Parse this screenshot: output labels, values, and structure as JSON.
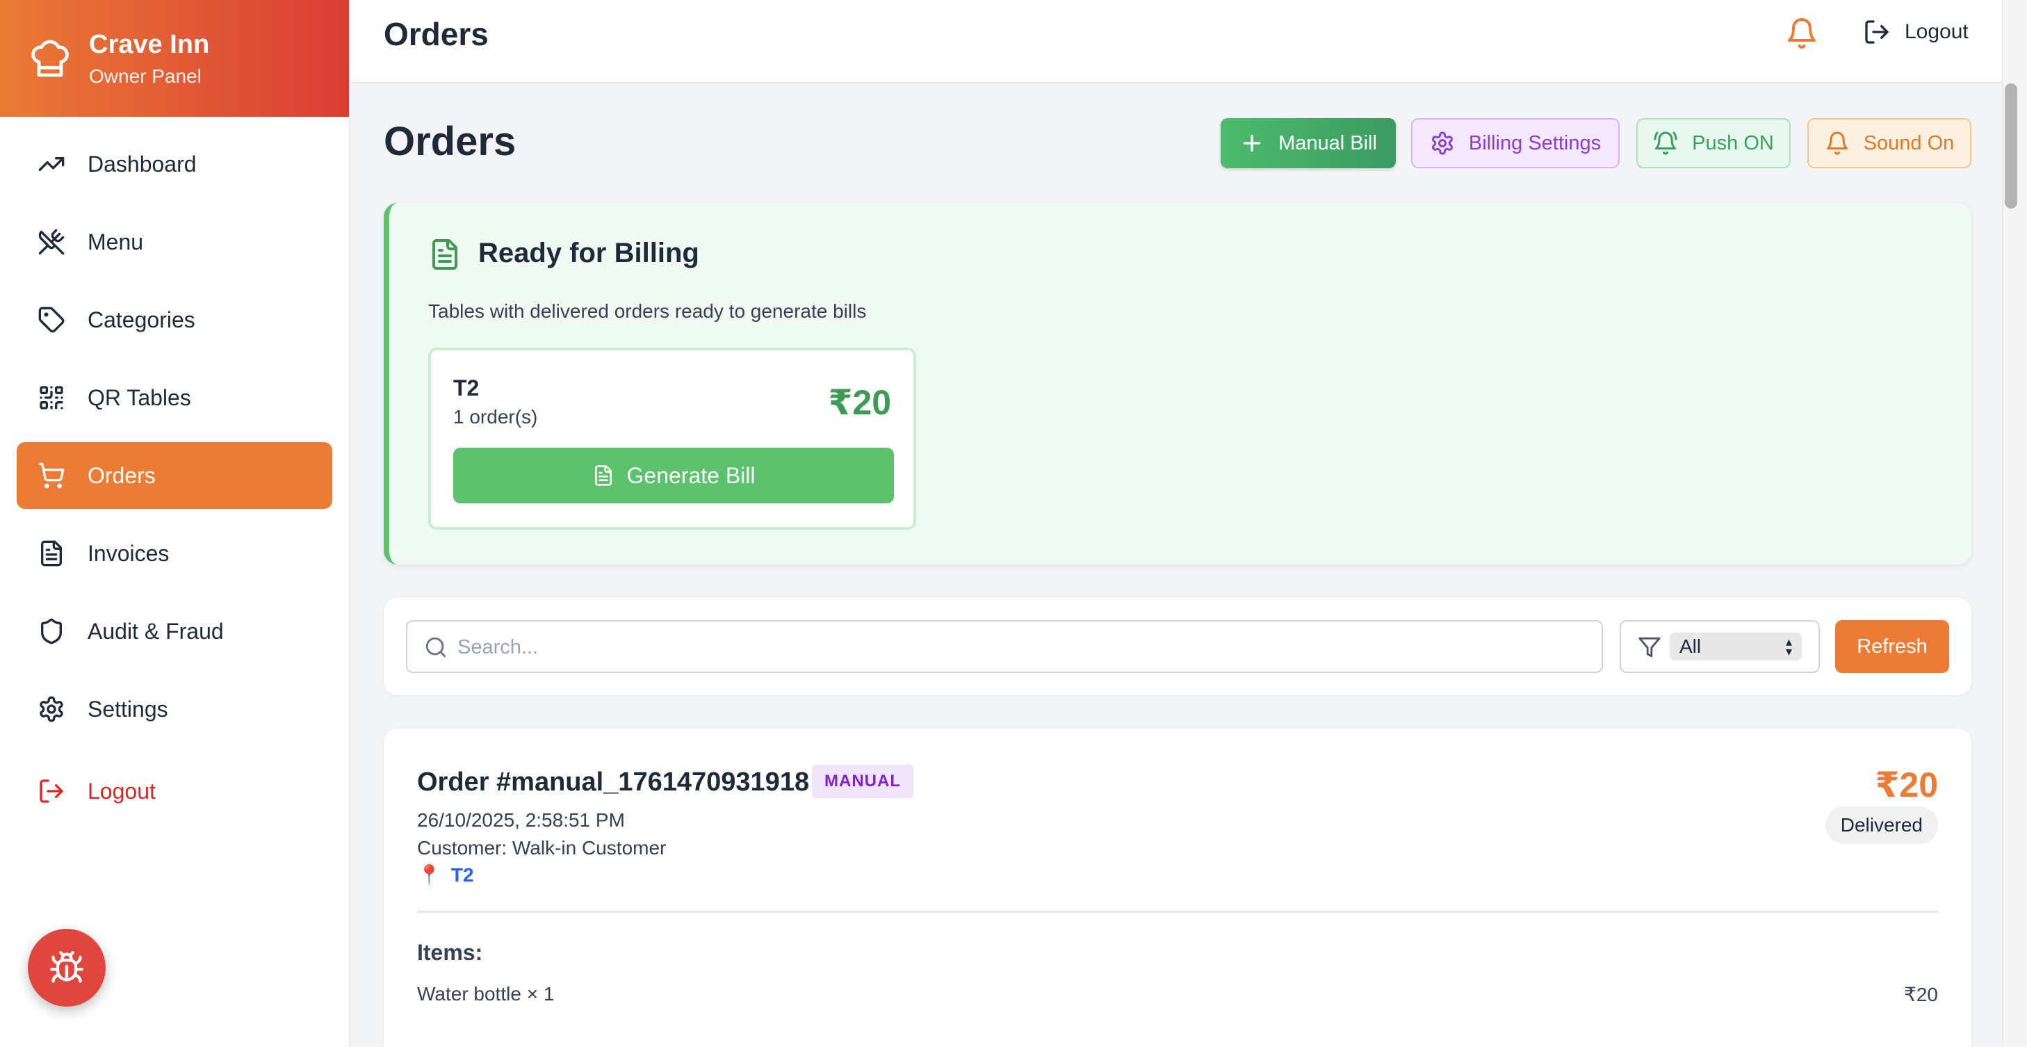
{
  "brand": {
    "title": "Crave Inn",
    "subtitle": "Owner Panel"
  },
  "sidebar": {
    "items": [
      {
        "label": "Dashboard",
        "icon": "trending-up-icon"
      },
      {
        "label": "Menu",
        "icon": "utensils-icon"
      },
      {
        "label": "Categories",
        "icon": "tag-icon"
      },
      {
        "label": "QR Tables",
        "icon": "qr-code-icon"
      },
      {
        "label": "Orders",
        "icon": "cart-icon",
        "active": true
      },
      {
        "label": "Invoices",
        "icon": "file-text-icon"
      },
      {
        "label": "Audit & Fraud",
        "icon": "shield-icon"
      },
      {
        "label": "Settings",
        "icon": "gear-icon"
      }
    ],
    "logout_label": "Logout"
  },
  "topbar": {
    "title": "Orders",
    "logout_label": "Logout"
  },
  "page": {
    "title": "Orders",
    "buttons": {
      "manual_bill": "Manual Bill",
      "billing_settings": "Billing Settings",
      "push": "Push ON",
      "sound": "Sound On"
    }
  },
  "billing": {
    "title": "Ready for Billing",
    "description": "Tables with delivered orders ready to generate bills",
    "tables": [
      {
        "table": "T2",
        "orders": "1 order(s)",
        "amount": "₹20",
        "button": "Generate Bill"
      }
    ]
  },
  "filters": {
    "search_placeholder": "Search...",
    "status_selected": "All",
    "refresh_label": "Refresh"
  },
  "orders": [
    {
      "id": "Order #manual_1761470931918",
      "badge": "MANUAL",
      "date": "26/10/2025, 2:58:51 PM",
      "customer": "Customer: Walk-in Customer",
      "table": "T2",
      "amount": "₹20",
      "status": "Delivered",
      "items_label": "Items:",
      "items": [
        {
          "name": "Water bottle × 1",
          "price": "₹20"
        }
      ]
    }
  ],
  "colors": {
    "accent": "#ec7b35",
    "logout_red": "#dc2626",
    "billing_green": "#5cc26d",
    "manual_purple": "#7e22ce",
    "table_link_blue": "#2563eb"
  }
}
